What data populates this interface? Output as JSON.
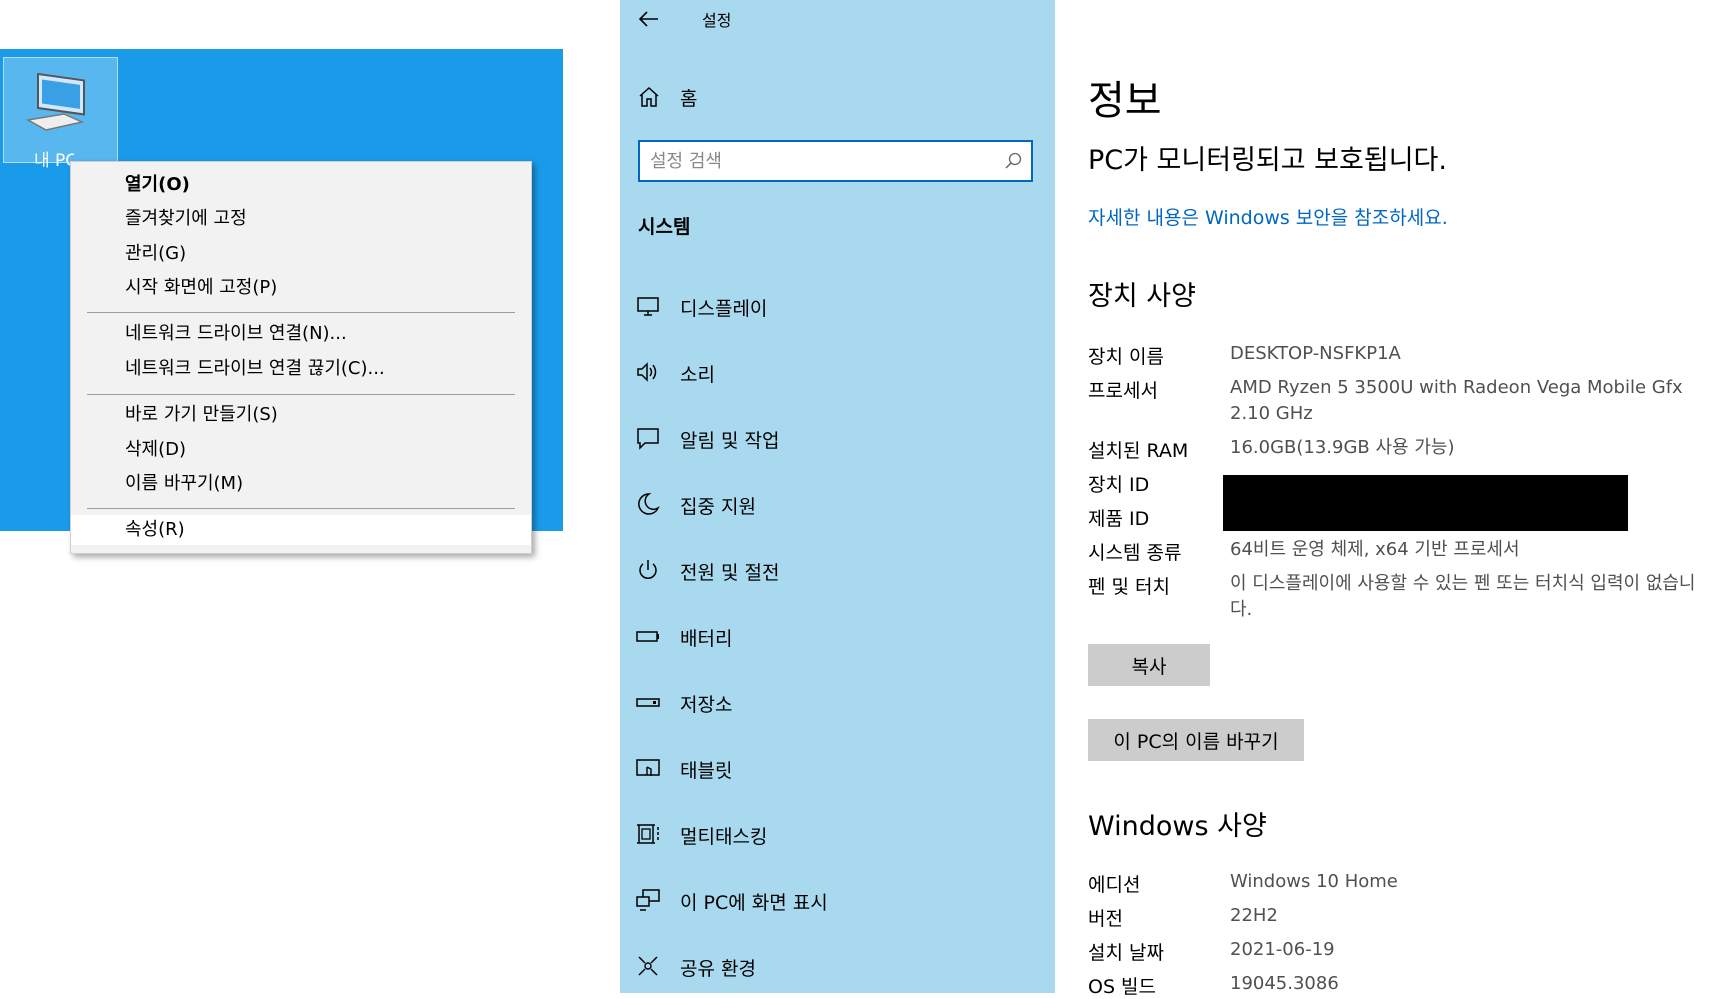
{
  "desktop": {
    "icon_label": "내 PC"
  },
  "context_menu": {
    "items": [
      {
        "label": "열기(O)"
      },
      {
        "label": "즐겨찾기에 고정"
      },
      {
        "label": "관리(G)"
      },
      {
        "label": "시작 화면에 고정(P)"
      },
      {
        "label": "네트워크 드라이브 연결(N)..."
      },
      {
        "label": "네트워크 드라이브 연결 끊기(C)..."
      },
      {
        "label": "바로 가기 만들기(S)"
      },
      {
        "label": "삭제(D)"
      },
      {
        "label": "이름 바꾸기(M)"
      },
      {
        "label": "속성(R)"
      }
    ]
  },
  "settings_nav": {
    "title": "설정",
    "home_label": "홈",
    "search_placeholder": "설정 검색",
    "section": "시스템",
    "items": [
      {
        "label": "디스플레이",
        "icon": "display-icon"
      },
      {
        "label": "소리",
        "icon": "speaker-icon"
      },
      {
        "label": "알림 및 작업",
        "icon": "notification-icon"
      },
      {
        "label": "집중 지원",
        "icon": "moon-icon"
      },
      {
        "label": "전원 및 절전",
        "icon": "power-icon"
      },
      {
        "label": "배터리",
        "icon": "battery-icon"
      },
      {
        "label": "저장소",
        "icon": "storage-icon"
      },
      {
        "label": "태블릿",
        "icon": "tablet-icon"
      },
      {
        "label": "멀티태스킹",
        "icon": "multitasking-icon"
      },
      {
        "label": "이 PC에 화면 표시",
        "icon": "project-icon"
      },
      {
        "label": "공유 환경",
        "icon": "share-icon"
      }
    ]
  },
  "about": {
    "title": "정보",
    "status": "PC가 모니터링되고 보호됩니다.",
    "security_link": "자세한 내용은 Windows 보안을 참조하세요.",
    "device_specs_heading": "장치 사양",
    "device_specs": [
      {
        "label": "장치 이름",
        "value": "DESKTOP-NSFKP1A"
      },
      {
        "label": "프로세서",
        "value": "AMD Ryzen 5 3500U with Radeon Vega Mobile Gfx 2.10 GHz"
      },
      {
        "label": "설치된 RAM",
        "value": "16.0GB(13.9GB 사용 가능)"
      },
      {
        "label": "장치 ID",
        "value": ""
      },
      {
        "label": "제품 ID",
        "value": ""
      },
      {
        "label": "시스템 종류",
        "value": "64비트 운영 체제, x64 기반 프로세서"
      },
      {
        "label": "펜 및 터치",
        "value": "이 디스플레이에 사용할 수 있는 펜 또는 터치식 입력이 없습니다."
      }
    ],
    "copy_button": "복사",
    "rename_button": "이 PC의 이름 바꾸기",
    "windows_specs_heading": "Windows 사양",
    "windows_specs": [
      {
        "label": "에디션",
        "value": "Windows 10 Home"
      },
      {
        "label": "버전",
        "value": "22H2"
      },
      {
        "label": "설치 날짜",
        "value": "2021-06-19"
      },
      {
        "label": "OS 빌드",
        "value": "19045.3086"
      }
    ]
  },
  "colors": {
    "desktop_bg": "#1a9bea",
    "nav_bg": "#a9d9ee",
    "accent": "#0067c0",
    "button_bg": "#cccccc"
  }
}
